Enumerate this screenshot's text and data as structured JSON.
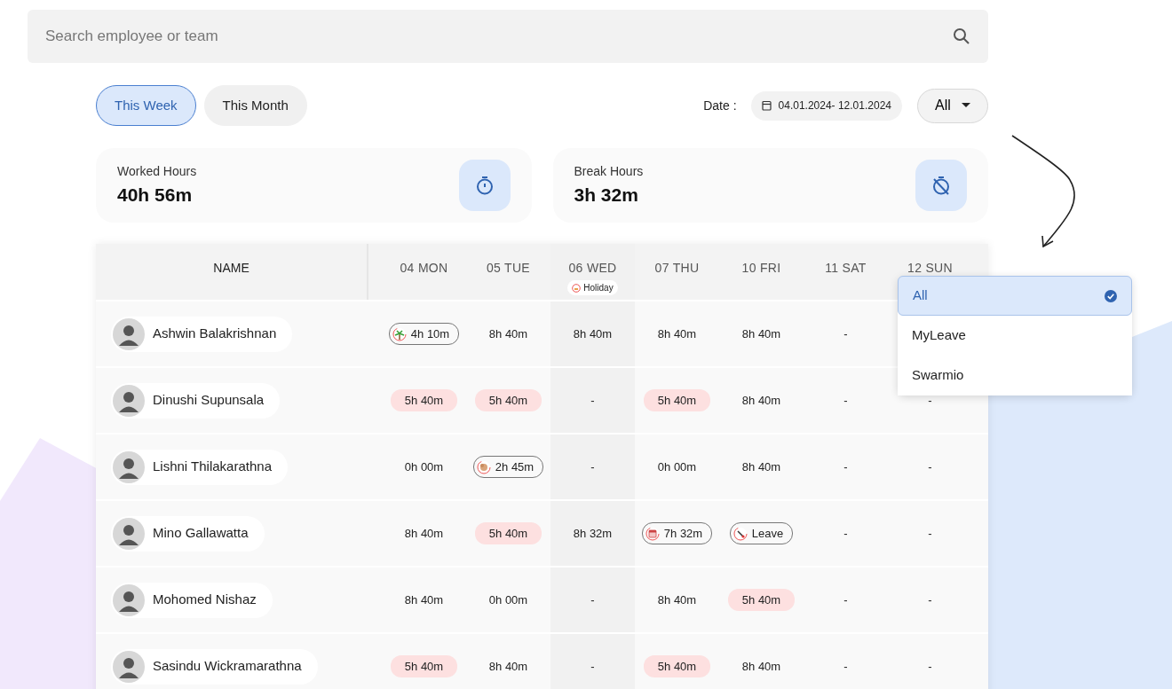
{
  "search": {
    "placeholder": "Search employee or team"
  },
  "period_tabs": [
    {
      "label": "This Week",
      "selected": true
    },
    {
      "label": "This Month",
      "selected": false
    }
  ],
  "date_filter": {
    "label": "Date :",
    "value": "04.01.2024- 12.01.2024"
  },
  "source_select": {
    "value": "All",
    "expanded": true
  },
  "stats": [
    {
      "label": "Worked Hours",
      "value": "40h 56m",
      "kind": "worked"
    },
    {
      "label": "Break Hours",
      "value": "3h 32m",
      "kind": "break"
    }
  ],
  "table": {
    "columns": [
      {
        "label": "NAME"
      },
      {
        "label": "04 MON"
      },
      {
        "label": "05 TUE"
      },
      {
        "label": "06 WED",
        "tag": "Holiday"
      },
      {
        "label": "07 THU"
      },
      {
        "label": "10 FRI"
      },
      {
        "label": "11 SAT"
      },
      {
        "label": "12 SUN"
      }
    ],
    "rows": [
      {
        "cells": [
          {
            "text": "Ashwin Balakrishnan",
            "kind": "employee"
          },
          {
            "text": "4h 10m",
            "kind": "vacation"
          },
          {
            "text": "8h 40m",
            "kind": "plain"
          },
          {
            "text": "8h 40m",
            "kind": "plain"
          },
          {
            "text": "8h 40m",
            "kind": "plain"
          },
          {
            "text": "8h 40m",
            "kind": "plain"
          },
          {
            "text": "-",
            "kind": "plain"
          }
        ]
      },
      {
        "cells": [
          {
            "text": "Dinushi Supunsala",
            "kind": "employee"
          },
          {
            "text": "5h 40m",
            "kind": "short"
          },
          {
            "text": "5h 40m",
            "kind": "short"
          },
          {
            "text": "-",
            "kind": "plain"
          },
          {
            "text": "5h 40m",
            "kind": "short"
          },
          {
            "text": "8h 40m",
            "kind": "plain"
          },
          {
            "text": "-",
            "kind": "plain"
          },
          {
            "text": "-",
            "kind": "plain"
          }
        ]
      },
      {
        "cells": [
          {
            "text": "Lishni Thilakarathna",
            "kind": "employee"
          },
          {
            "text": "0h 00m",
            "kind": "plain"
          },
          {
            "text": "2h 45m",
            "kind": "pause"
          },
          {
            "text": "-",
            "kind": "plain"
          },
          {
            "text": "0h 00m",
            "kind": "plain"
          },
          {
            "text": "8h 40m",
            "kind": "plain"
          },
          {
            "text": "-",
            "kind": "plain"
          },
          {
            "text": "-",
            "kind": "plain"
          }
        ]
      },
      {
        "cells": [
          {
            "text": "Mino Gallawatta",
            "kind": "employee"
          },
          {
            "text": "8h 40m",
            "kind": "plain"
          },
          {
            "text": "5h 40m",
            "kind": "short"
          },
          {
            "text": "8h 32m",
            "kind": "plain"
          },
          {
            "text": "7h 32m",
            "kind": "event"
          },
          {
            "text": "Leave",
            "kind": "leave"
          },
          {
            "text": "-",
            "kind": "plain"
          },
          {
            "text": "-",
            "kind": "plain"
          }
        ]
      },
      {
        "cells": [
          {
            "text": "Mohomed Nishaz",
            "kind": "employee"
          },
          {
            "text": "8h 40m",
            "kind": "plain"
          },
          {
            "text": "0h 00m",
            "kind": "plain"
          },
          {
            "text": "-",
            "kind": "plain"
          },
          {
            "text": "8h 40m",
            "kind": "plain"
          },
          {
            "text": "5h 40m",
            "kind": "short"
          },
          {
            "text": "-",
            "kind": "plain"
          },
          {
            "text": "-",
            "kind": "plain"
          }
        ]
      },
      {
        "cells": [
          {
            "text": "Sasindu Wickramarathna",
            "kind": "employee"
          },
          {
            "text": "5h 40m",
            "kind": "short"
          },
          {
            "text": "8h 40m",
            "kind": "plain"
          },
          {
            "text": "-",
            "kind": "plain"
          },
          {
            "text": "5h 40m",
            "kind": "short"
          },
          {
            "text": "8h 40m",
            "kind": "plain"
          },
          {
            "text": "-",
            "kind": "plain"
          },
          {
            "text": "-",
            "kind": "plain"
          }
        ]
      }
    ]
  },
  "dropdown": {
    "options": [
      {
        "label": "All",
        "selected": true
      },
      {
        "label": "MyLeave",
        "selected": false
      },
      {
        "label": "Swarmio",
        "selected": false
      }
    ]
  }
}
